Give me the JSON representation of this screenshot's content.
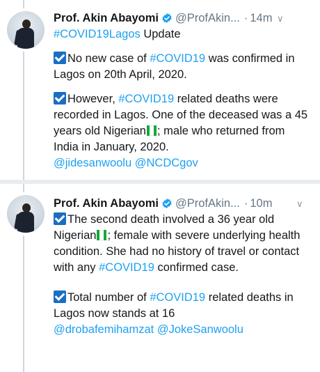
{
  "tweets": [
    {
      "author": "Prof. Akin Abayomi",
      "handle": "@ProfAkin...",
      "dot": "·",
      "time": "14m",
      "line1_tag": "#COVID19Lagos",
      "line1_rest": " Update",
      "para1_a": "No new case of ",
      "para1_tag": "#COVID19",
      "para1_b": "  was confirmed in Lagos on 20th April, 2020.",
      "para2_a": "However, ",
      "para2_tag": "#COVID19",
      "para2_b": " related deaths were recorded in Lagos. One of the deceased was a 45 years old Nigerian",
      "para2_c": "; male who returned from India in January, 2020.",
      "mention1": "@jidesanwoolu",
      "mention2": "@NCDCgov"
    },
    {
      "author": "Prof. Akin Abayomi",
      "handle": "@ProfAkin...",
      "dot": "·",
      "time": "10m",
      "para1_a": "The second death involved a 36 year old Nigerian",
      "para1_b": "; female with severe underlying health condition. She had no history of travel or contact with any ",
      "para1_tag": "#COVID19",
      "para1_c": " confirmed case.",
      "para2_a": "Total number of ",
      "para2_tag": "#COVID19",
      "para2_b": " related deaths in Lagos now stands at 16",
      "mention1": "@drobafemihamzat",
      "mention2": "@JokeSanwoolu"
    }
  ],
  "colors": {
    "link": "#1da1f2",
    "verified": "#1da1f2",
    "checkbox": "#1b6ec2",
    "flag_green": "#14a83b"
  },
  "icons": [
    "verified-badge-icon",
    "chevron-down-icon",
    "check-mark-icon",
    "nigeria-flag-icon"
  ]
}
